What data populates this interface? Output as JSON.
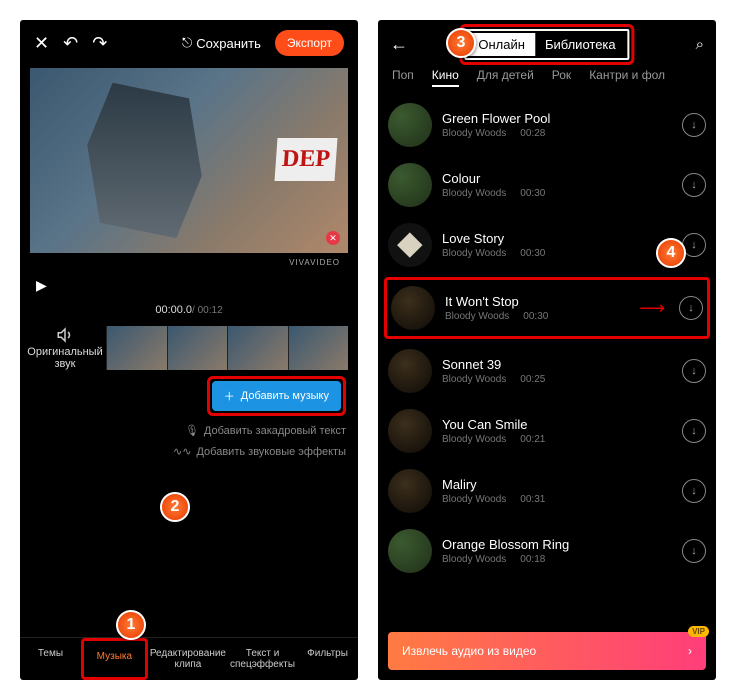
{
  "left": {
    "toolbar": {
      "save_label": "Сохранить",
      "export_label": "Экспорт"
    },
    "watermark": "VIVAVIDEO",
    "timecode": {
      "current": "00:00.0",
      "total": "/ 00:12"
    },
    "original_audio_label": "Оригинальный звук",
    "add_music_label": "Добавить музыку",
    "add_vo_label": "Добавить закадровый текст",
    "add_sfx_label": "Добавить звуковые эффекты",
    "tabs": {
      "themes": "Темы",
      "music": "Музыка",
      "edit_clip": "Редактирование\nклипа",
      "text_fx": "Текст и спецэффекты",
      "filters": "Фильтры"
    },
    "badges": {
      "one": "1",
      "two": "2"
    }
  },
  "right": {
    "segments": {
      "online": "Онлайн",
      "library": "Библиотека"
    },
    "genres": [
      "Поп",
      "Кино",
      "Для детей",
      "Рок",
      "Кантри и фол"
    ],
    "active_genre": "Кино",
    "tracks": [
      {
        "title": "Green Flower Pool",
        "artist": "Bloody Woods",
        "dur": "00:28"
      },
      {
        "title": "Colour",
        "artist": "Bloody Woods",
        "dur": "00:30"
      },
      {
        "title": "Love Story",
        "artist": "Bloody Woods",
        "dur": "00:30"
      },
      {
        "title": "It Won't Stop",
        "artist": "Bloody Woods",
        "dur": "00:30"
      },
      {
        "title": "Sonnet 39",
        "artist": "Bloody Woods",
        "dur": "00:25"
      },
      {
        "title": "You Can Smile",
        "artist": "Bloody Woods",
        "dur": "00:21"
      },
      {
        "title": "Maliry",
        "artist": "Bloody Woods",
        "dur": "00:31"
      },
      {
        "title": "Orange Blossom Ring",
        "artist": "Bloody Woods",
        "dur": "00:18"
      }
    ],
    "extract_label": "Извлечь аудио из видео",
    "vip": "VIP",
    "badges": {
      "three": "3",
      "four": "4"
    }
  }
}
